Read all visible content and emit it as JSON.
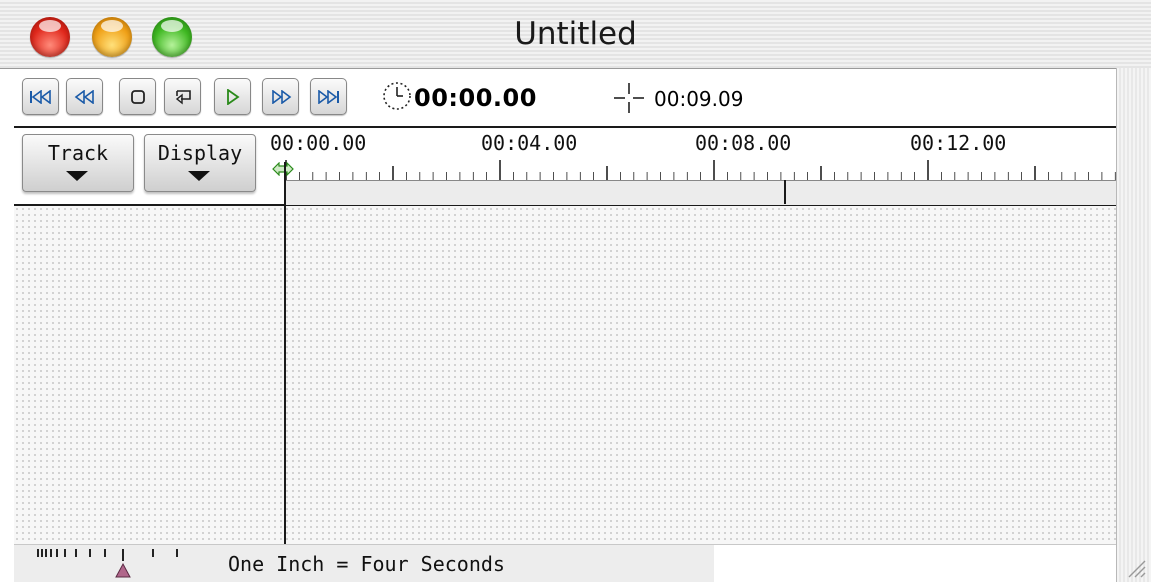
{
  "window": {
    "title": "Untitled"
  },
  "transport": {
    "buttons": [
      {
        "name": "rewind-to-start-button",
        "icon": "skip-to-start-icon"
      },
      {
        "name": "step-back-button",
        "icon": "step-back-icon"
      },
      {
        "name": "stop-button",
        "icon": "stop-icon"
      },
      {
        "name": "loop-button",
        "icon": "loop-icon"
      },
      {
        "name": "play-button",
        "icon": "play-icon"
      },
      {
        "name": "step-forward-button",
        "icon": "step-forward-icon"
      },
      {
        "name": "skip-to-end-button",
        "icon": "skip-to-end-icon"
      }
    ],
    "current_time": "00:00.00",
    "duration": "00:09.09"
  },
  "header": {
    "track_label": "Track",
    "display_label": "Display",
    "ticks": [
      "00:00.00",
      "00:04.00",
      "00:08.00",
      "00:12.00"
    ]
  },
  "status": {
    "scale_text": "One Inch = Four Seconds"
  },
  "colors": {
    "accent_green": "#2a8a1a",
    "zoom_thumb": "#b0668a"
  }
}
